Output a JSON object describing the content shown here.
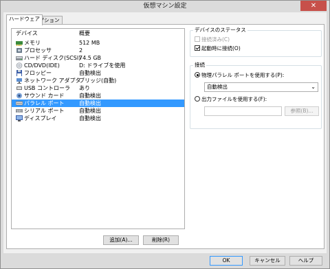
{
  "window": {
    "title": "仮想マシン設定",
    "close_glyph": "✕"
  },
  "tabs": [
    {
      "label": "ハードウェア",
      "active": true
    },
    {
      "label": "オプション",
      "active": false
    }
  ],
  "device_list": {
    "header_device": "デバイス",
    "header_summary": "概要",
    "rows": [
      {
        "name": "メモリ",
        "summary": "512 MB",
        "icon": "memory-icon",
        "selected": false
      },
      {
        "name": "プロセッサ",
        "summary": "2",
        "icon": "processor-icon",
        "selected": false
      },
      {
        "name": "ハード ディスク(SCSI)",
        "summary": "74.5 GB",
        "icon": "hard-disk-icon",
        "selected": false
      },
      {
        "name": "CD/DVD(IDE)",
        "summary": "D: ドライブを使用",
        "icon": "cd-dvd-icon",
        "selected": false
      },
      {
        "name": "フロッピー",
        "summary": "自動検出",
        "icon": "floppy-icon",
        "selected": false
      },
      {
        "name": "ネットワーク アダプタ",
        "summary": "ブリッジ(自動)",
        "icon": "network-adapter-icon",
        "selected": false
      },
      {
        "name": "USB コントローラ",
        "summary": "あり",
        "icon": "usb-icon",
        "selected": false
      },
      {
        "name": "サウンド カード",
        "summary": "自動検出",
        "icon": "sound-card-icon",
        "selected": false
      },
      {
        "name": "パラレル ポート",
        "summary": "自動検出",
        "icon": "parallel-port-icon",
        "selected": true
      },
      {
        "name": "シリアル ポート",
        "summary": "自動検出",
        "icon": "serial-port-icon",
        "selected": false
      },
      {
        "name": "ディスプレイ",
        "summary": "自動検出",
        "icon": "display-icon",
        "selected": false
      }
    ]
  },
  "list_buttons": {
    "add": "追加(A)...",
    "remove": "削除(R)"
  },
  "device_status": {
    "group_label": "デバイスのステータス",
    "connected": {
      "label": "接続済み(C)",
      "checked": false,
      "enabled": false
    },
    "connect_at_power_on": {
      "label": "起動時に接続(O)",
      "checked": true,
      "enabled": true
    }
  },
  "connection": {
    "group_label": "接続",
    "physical": {
      "label": "物理パラレル ポートを使用する(P):",
      "checked": true
    },
    "physical_select_value": "自動検出",
    "output_file": {
      "label": "出力ファイルを使用する(F):",
      "checked": false
    },
    "output_file_value": "",
    "browse": "参照(B)..."
  },
  "footer": {
    "ok": "OK",
    "cancel": "キャンセル",
    "help": "ヘルプ"
  },
  "colors": {
    "selection": "#3399ff",
    "close_button": "#c7504a"
  }
}
